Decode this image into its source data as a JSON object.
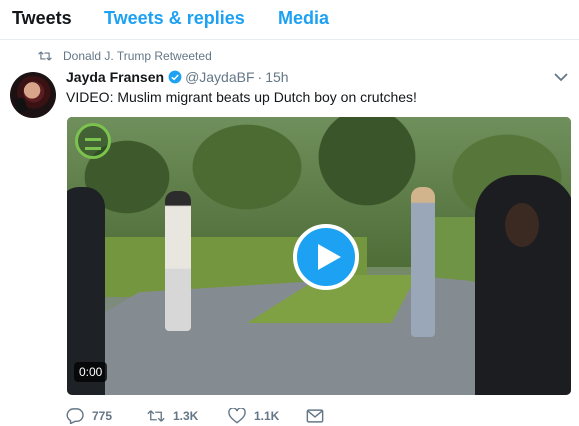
{
  "tabs": {
    "tweets": "Tweets",
    "replies": "Tweets & replies",
    "media": "Media"
  },
  "retweet_context": "Donald J. Trump Retweeted",
  "tweet": {
    "fullname": "Jayda Fransen",
    "username": "@JaydaBF",
    "separator": "·",
    "time": "15h",
    "text": "VIDEO: Muslim migrant beats up Dutch boy on crutches!",
    "video_duration": "0:00"
  },
  "actions": {
    "replies": "775",
    "retweets": "1.3K",
    "likes": "1.1K"
  },
  "colors": {
    "accent": "#1da1f2",
    "text": "#14171a",
    "muted": "#657786"
  },
  "icons": [
    "retweet-icon",
    "verified-badge-icon",
    "chevron-down-icon",
    "play-icon",
    "reply-icon",
    "like-icon",
    "direct-message-icon"
  ]
}
